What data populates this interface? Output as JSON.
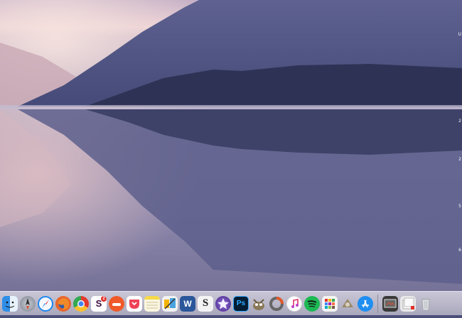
{
  "desktop": {
    "wallpaper": "lake-mountain-reflection",
    "edge_marks": [
      "U",
      "2",
      "2",
      "5",
      "6"
    ]
  },
  "dock": {
    "items": [
      {
        "name": "finder-icon",
        "color": "#2f8ee8"
      },
      {
        "name": "launchpad-icon",
        "color": "#8a8f9a"
      },
      {
        "name": "safari-icon",
        "color": "#1e87f0"
      },
      {
        "name": "firefox-icon",
        "color": "#e8662a"
      },
      {
        "name": "chrome-icon",
        "color": "#e3392e"
      },
      {
        "name": "slack-icon",
        "color": "#ffffff",
        "label": "S",
        "badge": "2"
      },
      {
        "name": "flow-icon",
        "color": "#f05a2a"
      },
      {
        "name": "pocket-icon",
        "color": "#ef4056"
      },
      {
        "name": "notes-icon",
        "color": "#f7e38a"
      },
      {
        "name": "photos-edit-icon",
        "color": "#f2f2f2"
      },
      {
        "name": "word-icon",
        "color": "#2b579a",
        "label": "W"
      },
      {
        "name": "scrivener-icon",
        "color": "#333333",
        "label": "S"
      },
      {
        "name": "imovie-icon",
        "color": "#6b3fb5"
      },
      {
        "name": "photoshop-icon",
        "color": "#001d34",
        "label": "Ps"
      },
      {
        "name": "gimp-icon",
        "color": "#8a7a5a"
      },
      {
        "name": "colorsync-icon",
        "color": "#5a5a5a"
      },
      {
        "name": "itunes-icon",
        "color": "#f2f2f2"
      },
      {
        "name": "spotify-icon",
        "color": "#1db954"
      },
      {
        "name": "grid-app-icon",
        "color": "#f4f4f4"
      },
      {
        "name": "automator-icon",
        "color": "#9a8a6a"
      },
      {
        "name": "app-store-icon",
        "color": "#1f8ef1"
      }
    ],
    "trailing": [
      {
        "name": "screen-capture-icon",
        "color": "#3a3a3a"
      },
      {
        "name": "downloads-stack-icon",
        "color": "#e9e9e9"
      },
      {
        "name": "trash-icon",
        "color": "#d4d6da"
      }
    ]
  }
}
